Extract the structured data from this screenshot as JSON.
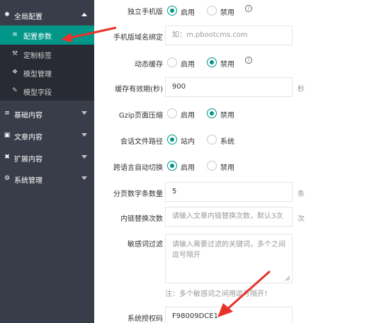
{
  "sidebar": {
    "groups": [
      {
        "label": "全局配置",
        "icon": "settings-gear-icon",
        "expanded": true
      },
      {
        "label": "基础内容",
        "icon": "sliders-icon",
        "expanded": false
      },
      {
        "label": "文章内容",
        "icon": "document-icon",
        "expanded": false
      },
      {
        "label": "扩展内容",
        "icon": "puzzle-icon",
        "expanded": false
      },
      {
        "label": "系统管理",
        "icon": "gear-icon",
        "expanded": false
      }
    ],
    "sub_items": [
      {
        "label": "配置参数",
        "icon": "sliders-icon",
        "active": true
      },
      {
        "label": "定制标签",
        "icon": "wrench-icon",
        "active": false
      },
      {
        "label": "模型管理",
        "icon": "cube-icon",
        "active": false
      },
      {
        "label": "模型字段",
        "icon": "edit-icon",
        "active": false
      }
    ]
  },
  "form": {
    "mobile_standalone": {
      "label": "独立手机版",
      "options": [
        "启用",
        "禁用"
      ],
      "selected": "启用"
    },
    "mobile_domain": {
      "label": "手机版域名绑定",
      "placeholder": "如：m.pbootcms.com"
    },
    "dynamic_cache": {
      "label": "动态缓存",
      "options": [
        "启用",
        "禁用"
      ],
      "selected": "禁用"
    },
    "cache_ttl": {
      "label": "缓存有效期(秒)",
      "value": "900",
      "unit": "秒"
    },
    "gzip": {
      "label": "Gzip页面压缩",
      "options": [
        "启用",
        "禁用"
      ],
      "selected": "禁用"
    },
    "session_path": {
      "label": "会话文件路径",
      "options": [
        "站内",
        "系统"
      ],
      "selected": "站内"
    },
    "lang_switch": {
      "label": "跨语言自动切换",
      "options": [
        "启用",
        "禁用"
      ],
      "selected": "启用"
    },
    "page_size": {
      "label": "分页数字条数量",
      "value": "5",
      "unit": "条"
    },
    "inner_link": {
      "label": "内链替换次数",
      "placeholder": "请输入文章内链替换次数，默认3次",
      "unit": "次"
    },
    "sensitive": {
      "label": "敏感词过滤",
      "placeholder": "请输入需要过滤的关键词，多个之间逗号隔开",
      "note": "注：多个敏感词之间用逗号隔开！"
    },
    "license": {
      "label": "系统授权码",
      "value": "F98009DCE1"
    }
  },
  "colors": {
    "sidebar_bg": "#393d49",
    "submenu_bg": "#282b33",
    "active": "#009688",
    "annotation_arrow": "#e8322a"
  }
}
